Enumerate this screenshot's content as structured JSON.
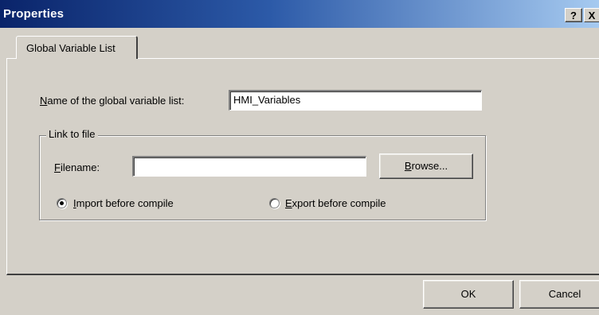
{
  "window": {
    "title": "Properties",
    "help_label": "?",
    "close_label": "X"
  },
  "tabs": [
    {
      "label": "Global Variable List",
      "selected": true
    }
  ],
  "form": {
    "name_label_first": "N",
    "name_label_rest": "ame of the global variable list:",
    "name_value": "HMI_Variables",
    "link_group_label": "Link to file",
    "filename_label_first": "F",
    "filename_label_rest": "ilename:",
    "filename_value": "",
    "browse_label_first": "B",
    "browse_label_rest": "rowse...",
    "import_label_first": "I",
    "import_label_rest": "mport before compile",
    "import_selected": true,
    "export_label_first": "E",
    "export_label_rest": "xport before compile",
    "export_selected": false
  },
  "footer": {
    "ok_label": "OK",
    "cancel_label": "Cancel"
  }
}
